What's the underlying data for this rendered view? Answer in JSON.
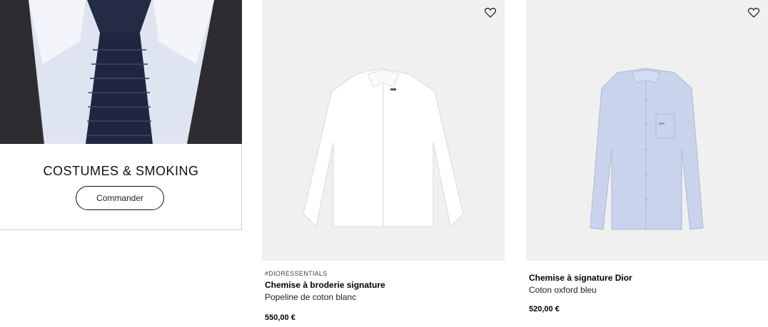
{
  "promo": {
    "title": "COSTUMES & SMOKING",
    "cta_label": "Commander"
  },
  "products": [
    {
      "tag": "#DIORESSENTIALS",
      "name": "Chemise à broderie signature",
      "description": "Popeline de coton blanc",
      "price": "550,00 €",
      "shirt_color": "#ffffff",
      "favorite_icon": "heart-outline-icon"
    },
    {
      "tag": "",
      "name": "Chemise à signature Dior",
      "description": "Coton oxford bleu",
      "price": "520,00 €",
      "shirt_color": "#c9d3ec",
      "favorite_icon": "heart-outline-icon"
    }
  ],
  "colors": {
    "image_background": "#f0f0f0",
    "suit": "#3a3a3e",
    "tie": "#1f2740"
  }
}
